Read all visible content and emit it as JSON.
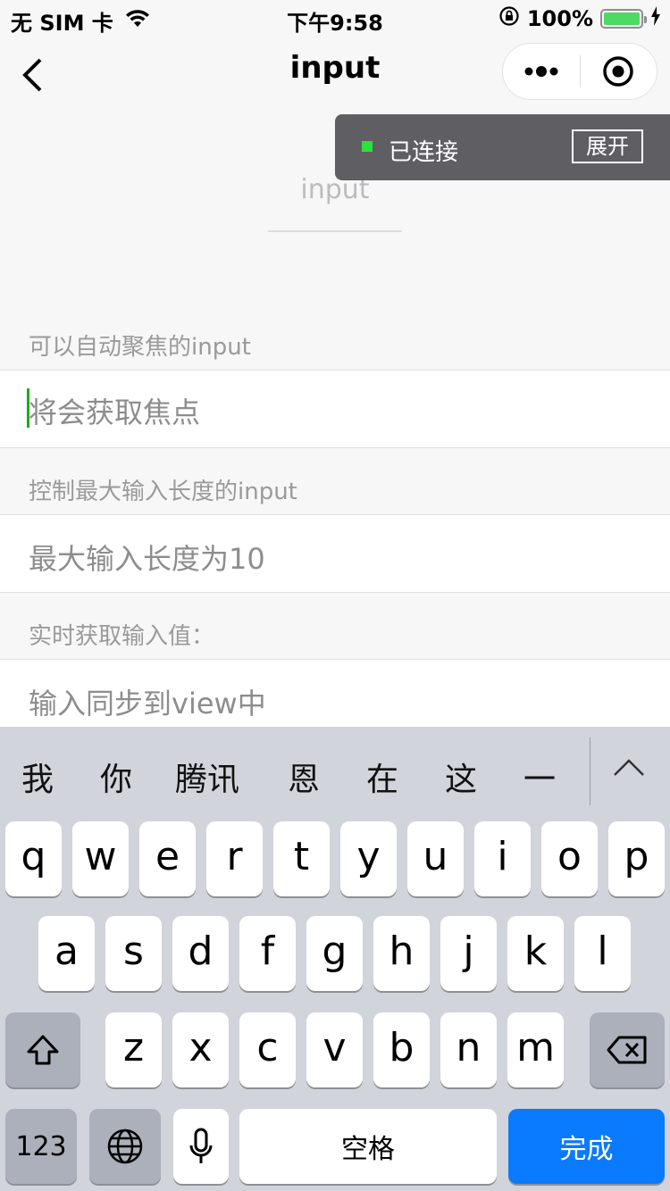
{
  "status_bar": {
    "carrier": "无 SIM 卡",
    "time": "下午9:58",
    "battery_percent": "100%"
  },
  "nav": {
    "title": "input"
  },
  "toast": {
    "status": "已连接",
    "expand_label": "展开"
  },
  "demo": {
    "placeholder": "input"
  },
  "sections": [
    {
      "label": "可以自动聚焦的input",
      "placeholder": "将会获取焦点"
    },
    {
      "label": "控制最大输入长度的input",
      "placeholder": "最大输入长度为10"
    },
    {
      "label": "实时获取输入值：",
      "placeholder": "输入同步到view中"
    }
  ],
  "keyboard": {
    "candidates": [
      "我",
      "你",
      "腾讯",
      "恩",
      "在",
      "这",
      "一"
    ],
    "row1": [
      "q",
      "w",
      "e",
      "r",
      "t",
      "y",
      "u",
      "i",
      "o",
      "p"
    ],
    "row2": [
      "a",
      "s",
      "d",
      "f",
      "g",
      "h",
      "j",
      "k",
      "l"
    ],
    "row3": [
      "z",
      "x",
      "c",
      "v",
      "b",
      "n",
      "m"
    ],
    "num_label": "123",
    "space_label": "空格",
    "done_label": "完成"
  },
  "colors": {
    "accent_green": "#1aad19",
    "done_blue": "#0a7afe",
    "toast_bg": "#5f5e63"
  }
}
